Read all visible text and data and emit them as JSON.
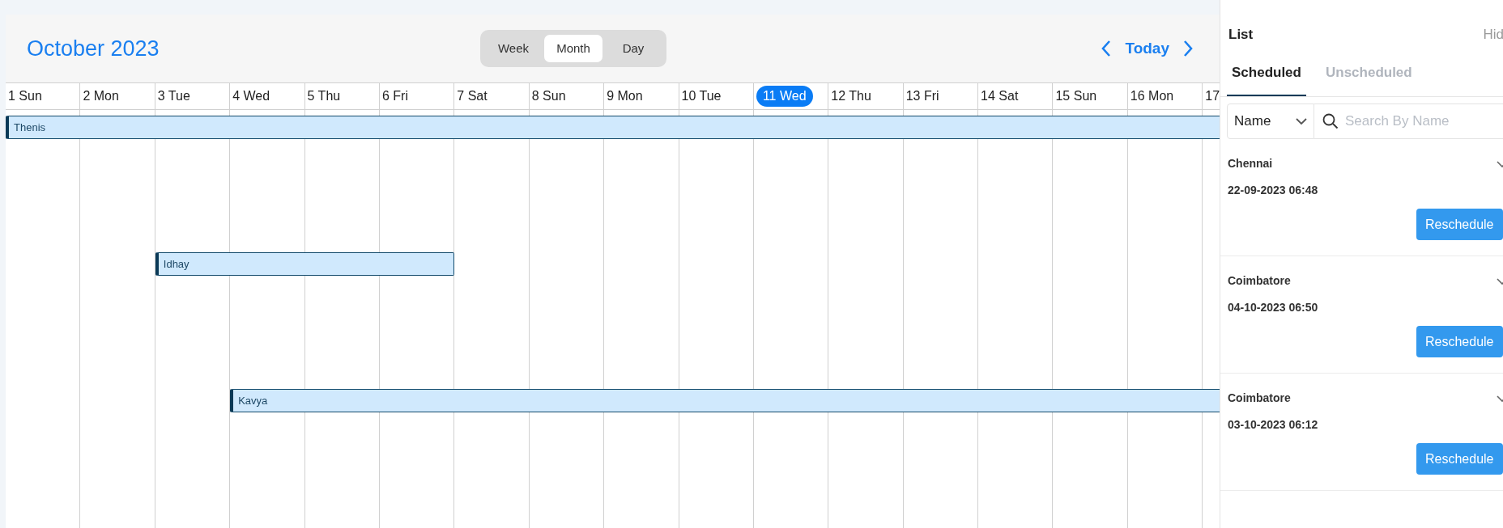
{
  "header": {
    "title": "October 2023",
    "views": [
      {
        "label": "Week",
        "selected": false
      },
      {
        "label": "Month",
        "selected": true
      },
      {
        "label": "Day",
        "selected": false
      }
    ],
    "today": "Today"
  },
  "days": [
    {
      "label": "1 Sun",
      "selected": false
    },
    {
      "label": "2 Mon",
      "selected": false
    },
    {
      "label": "3 Tue",
      "selected": false
    },
    {
      "label": "4 Wed",
      "selected": false
    },
    {
      "label": "5 Thu",
      "selected": false
    },
    {
      "label": "6 Fri",
      "selected": false
    },
    {
      "label": "7 Sat",
      "selected": false
    },
    {
      "label": "8 Sun",
      "selected": false
    },
    {
      "label": "9 Mon",
      "selected": false
    },
    {
      "label": "10 Tue",
      "selected": false
    },
    {
      "label": "11 Wed",
      "selected": true
    },
    {
      "label": "12 Thu",
      "selected": false
    },
    {
      "label": "13 Fri",
      "selected": false
    },
    {
      "label": "14 Sat",
      "selected": false
    },
    {
      "label": "15 Sun",
      "selected": false
    },
    {
      "label": "16 Mon",
      "selected": false
    },
    {
      "label": "17",
      "selected": false
    }
  ],
  "events": [
    {
      "name": "Thenis"
    },
    {
      "name": "Idhay"
    },
    {
      "name": "Kavya"
    }
  ],
  "panel": {
    "title": "List",
    "hide": "Hid",
    "tabs": [
      {
        "label": "Scheduled",
        "selected": true
      },
      {
        "label": "Unscheduled",
        "selected": false
      }
    ],
    "filter": "Name",
    "search": {
      "placeholder": "Search By Name"
    },
    "items": [
      {
        "city": "Chennai",
        "date": "22-09-2023 06:48",
        "action": "Reschedule"
      },
      {
        "city": "Coimbatore",
        "date": "04-10-2023 06:50",
        "action": "Reschedule"
      },
      {
        "city": "Coimbatore",
        "date": "03-10-2023 06:12",
        "action": "Reschedule"
      }
    ]
  }
}
